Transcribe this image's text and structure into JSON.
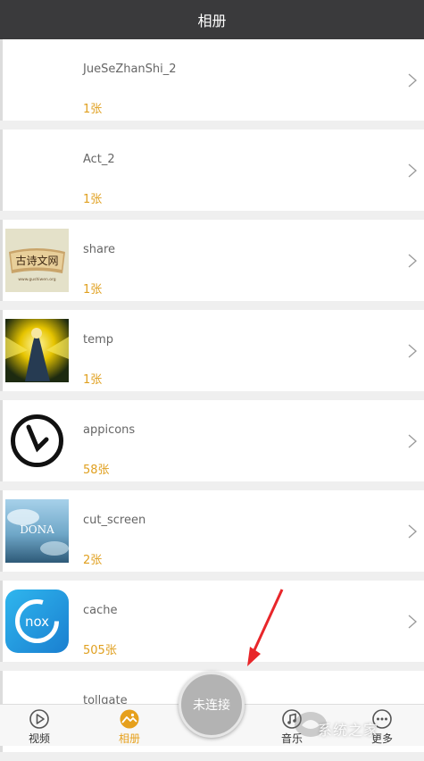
{
  "header": {
    "title": "相册"
  },
  "albums": [
    {
      "name": "JueSeZhanShi_2",
      "count": "1张",
      "thumb": "none"
    },
    {
      "name": "Act_2",
      "count": "1张",
      "thumb": "none"
    },
    {
      "name": "share",
      "count": "1张",
      "thumb": "share"
    },
    {
      "name": "temp",
      "count": "1张",
      "thumb": "temp"
    },
    {
      "name": "appicons",
      "count": "58张",
      "thumb": "appicons"
    },
    {
      "name": "cut_screen",
      "count": "2张",
      "thumb": "cut_screen"
    },
    {
      "name": "cache",
      "count": "505张",
      "thumb": "cache"
    },
    {
      "name": "tollgate",
      "count": "",
      "thumb": "none"
    }
  ],
  "thumb_text": {
    "share_logo": "古诗文网",
    "share_url": "www.gushiwen.org",
    "cut_screen_logo": "DONA",
    "cache_logo": "nox"
  },
  "tabbar": {
    "tabs": [
      {
        "label": "视频",
        "icon": "play-icon",
        "active": false
      },
      {
        "label": "相册",
        "icon": "photo-icon",
        "active": true
      },
      {
        "label": "音乐",
        "icon": "music-icon",
        "active": false
      },
      {
        "label": "更多",
        "icon": "more-icon",
        "active": false
      }
    ],
    "center_button": "未连接"
  },
  "watermark": {
    "text": "系统之家"
  },
  "colors": {
    "header_bg": "#3a3a3c",
    "accent": "#e6a01c",
    "count_text": "#e0a020"
  }
}
